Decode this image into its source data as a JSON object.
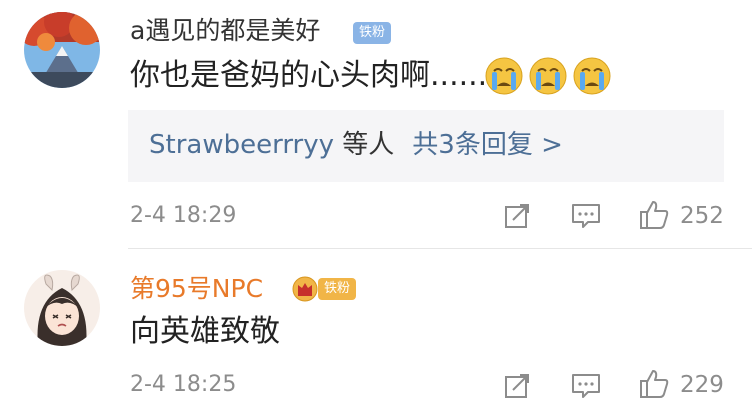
{
  "comments": [
    {
      "username": "a遇见的都是美好",
      "badge": "铁粉",
      "text": "你也是爸妈的心头肉啊......",
      "emoji": "crying-face-icon",
      "replies": {
        "user": "Strawbeerrryy",
        "suffix": " 等人",
        "count": "共3条回复 >"
      },
      "timestamp": "2-4 18:29",
      "likes": "252"
    },
    {
      "username": "第95号NPC",
      "badge": "铁粉",
      "text": "向英雄致敬",
      "timestamp": "2-4 18:25",
      "likes": "229"
    }
  ],
  "colors": {
    "username_default": "#333333",
    "username_vip": "#e87a2a",
    "badge_blue": "#8ab4e6",
    "badge_gold": "#f1b547",
    "link": "#4d6f96",
    "meta_gray": "#8c8c8c"
  },
  "icons": [
    "share-icon",
    "comment-icon",
    "like-icon",
    "crown-icon"
  ]
}
